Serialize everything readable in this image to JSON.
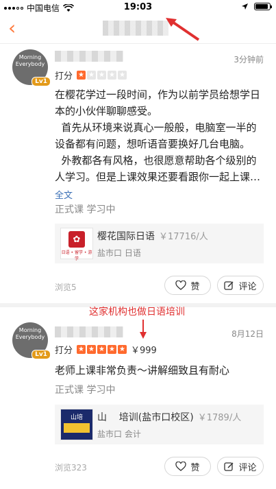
{
  "status_bar": {
    "carrier": "中国电信",
    "time": "19:03"
  },
  "nav": {
    "back_icon": "chevron-left-icon"
  },
  "reviews": [
    {
      "avatar_text": "Morning Everybody",
      "level": "Lv1",
      "date": "3分钟前",
      "rating_label": "打分",
      "stars": 1,
      "price": "",
      "body_lines": [
        "在樱花学过一段时间，作为以前学员给想学日",
        "本的小伙伴聊聊感受。",
        "  首先从环境来说真心一般般，电脑室一半的",
        "设备都有问题，想听语音要换好几台电脑。",
        "  外教都各有风格，也很愿意帮助各个级别的",
        "人学习。但是上课效果还要看跟你一起上课…"
      ],
      "more_label": "全文",
      "category": "正式课 学习中",
      "org": {
        "name": "樱花国际日语",
        "price": "￥17716/人",
        "location": "盐市口 日语",
        "logo_text": "日语 • 留学 • 游学"
      },
      "views": "浏览5",
      "like_label": "赞",
      "comment_label": "评论"
    },
    {
      "avatar_text": "Morning Everybody",
      "level": "Lv1",
      "date": "8月12日",
      "rating_label": "打分",
      "stars": 5,
      "price": "￥999",
      "body_lines": [
        "老师上课非常负责～讲解细致且有耐心"
      ],
      "more_label": "",
      "category": "正式课 学习中",
      "org": {
        "name": "山    培训(盐市口校区)",
        "price": "￥1789/人",
        "location": "盐市口 会计",
        "logo_text": "山培"
      },
      "views": "浏览323",
      "like_label": "赞",
      "comment_label": "评论"
    }
  ],
  "annotation": "这家机构也做日语培训",
  "colors": {
    "accent": "#ff7a3d",
    "star": "#ff6a2e",
    "annotation": "#e03030"
  }
}
